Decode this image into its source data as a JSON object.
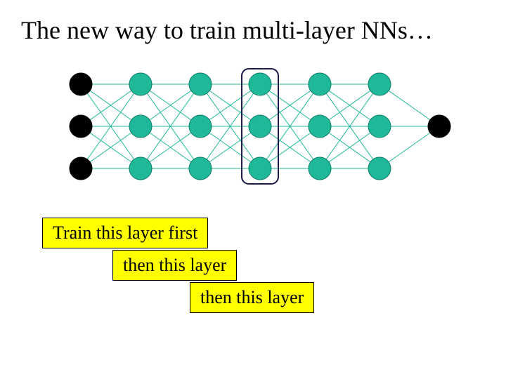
{
  "title": "The new way to train multi-layer NNs…",
  "captions": {
    "c1": "Train this layer first",
    "c2": "then this layer",
    "c3": "then this layer"
  },
  "diagram": {
    "colors": {
      "node_fill": "#1fb99a",
      "node_stroke": "#0b7c67",
      "input_fill": "#000000",
      "output_fill": "#000000",
      "edge": "#1fb99a",
      "highlight_box": "#1a1a4d"
    },
    "layers": [
      {
        "name": "input",
        "count": 3,
        "color": "input"
      },
      {
        "name": "h1",
        "count": 3,
        "color": "hidden"
      },
      {
        "name": "h2",
        "count": 3,
        "color": "hidden"
      },
      {
        "name": "h3",
        "count": 3,
        "color": "hidden"
      },
      {
        "name": "h4",
        "count": 3,
        "color": "hidden"
      },
      {
        "name": "h5",
        "count": 3,
        "color": "hidden"
      },
      {
        "name": "output",
        "count": 1,
        "color": "output"
      }
    ],
    "connectivity": "fully-connected between adjacent layers",
    "highlighted_layer_index": 3
  }
}
